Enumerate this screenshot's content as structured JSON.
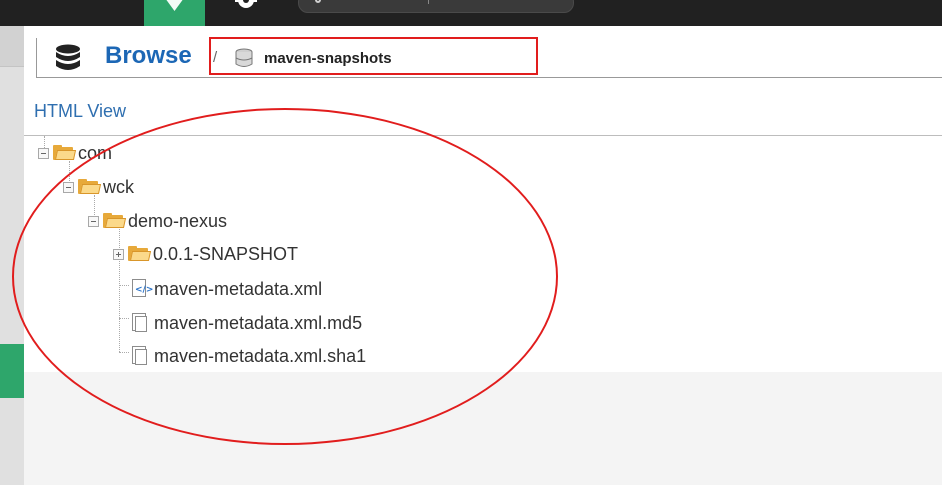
{
  "header": {
    "title": "Browse",
    "separator": "/",
    "repository": "maven-snapshots"
  },
  "view": {
    "link_label": "HTML View"
  },
  "tree": {
    "items": [
      {
        "label": "com",
        "type": "folder",
        "expanded": true
      },
      {
        "label": "wck",
        "type": "folder",
        "expanded": true
      },
      {
        "label": "demo-nexus",
        "type": "folder",
        "expanded": true
      },
      {
        "label": "0.0.1-SNAPSHOT",
        "type": "folder",
        "expanded": false
      },
      {
        "label": "maven-metadata.xml",
        "type": "xml-file"
      },
      {
        "label": "maven-metadata.xml.md5",
        "type": "file"
      },
      {
        "label": "maven-metadata.xml.sha1",
        "type": "file"
      }
    ]
  },
  "colors": {
    "accent_green": "#2ea66b",
    "title_blue": "#1c67b5",
    "annotation_red": "#e11d1d",
    "topbar": "#212121"
  },
  "icons": {
    "topbar": [
      "components-icon",
      "gear-icon",
      "search-icon"
    ],
    "header": [
      "database-icon"
    ],
    "breadcrumb": [
      "repository-icon"
    ]
  }
}
